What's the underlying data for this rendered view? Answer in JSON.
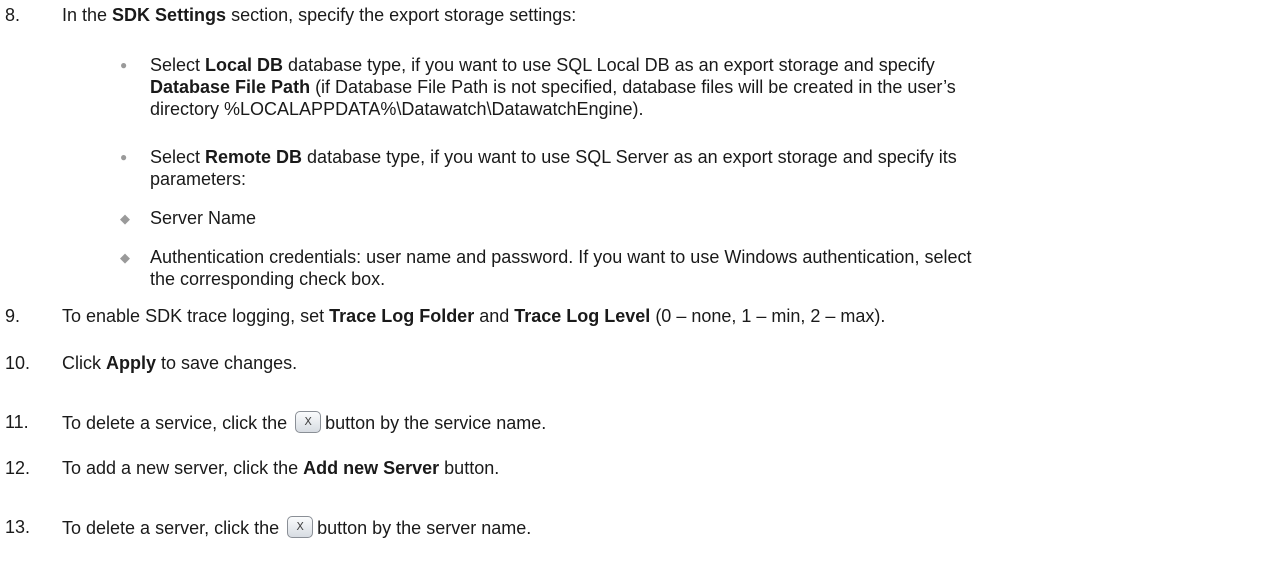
{
  "steps": {
    "s8": {
      "num": "8.",
      "pre": "In the ",
      "bold1": "SDK Settings",
      "post": " section, specify the export storage settings:"
    },
    "b1": {
      "pre": "Select ",
      "bold1": "Local DB",
      "mid1": " database type, if you want to use SQL Local DB as an export storage and specify",
      "bold2": "Database File Path",
      "mid2": " (if Database File Path is not specified, database files will be created in the user’s",
      "line3": "directory %LOCALAPPDATA%\\Datawatch\\DatawatchEngine)."
    },
    "b2": {
      "pre": "Select ",
      "bold1": "Remote DB",
      "mid1": " database type, if you want to use SQL Server as an export storage and specify its",
      "line2": "parameters:"
    },
    "d1": {
      "text": "Server Name"
    },
    "d2": {
      "line1": "Authentication credentials: user name and password. If you want to use Windows authentication, select",
      "line2": "the corresponding check box."
    },
    "s9": {
      "num": "9.",
      "pre": "To enable SDK trace logging, set ",
      "bold1": "Trace Log Folder",
      "mid": " and ",
      "bold2": "Trace Log Level",
      "post": " (0 – none, 1 – min, 2 – max)."
    },
    "s10": {
      "num": "10.",
      "pre": "Click ",
      "bold1": "Apply",
      "post": " to save changes."
    },
    "s11": {
      "num": "11.",
      "pre": "To delete a service, click the ",
      "post": "button by the service name."
    },
    "s12": {
      "num": "12.",
      "pre": "To add a new server, click the ",
      "bold1": "Add new Server",
      "post": " button."
    },
    "s13": {
      "num": "13.",
      "pre": "To delete a server, click the ",
      "post": "button by the server name."
    }
  },
  "icons": {
    "delete_button_glyph": "X",
    "bullet": "●",
    "diamond": "◆"
  }
}
